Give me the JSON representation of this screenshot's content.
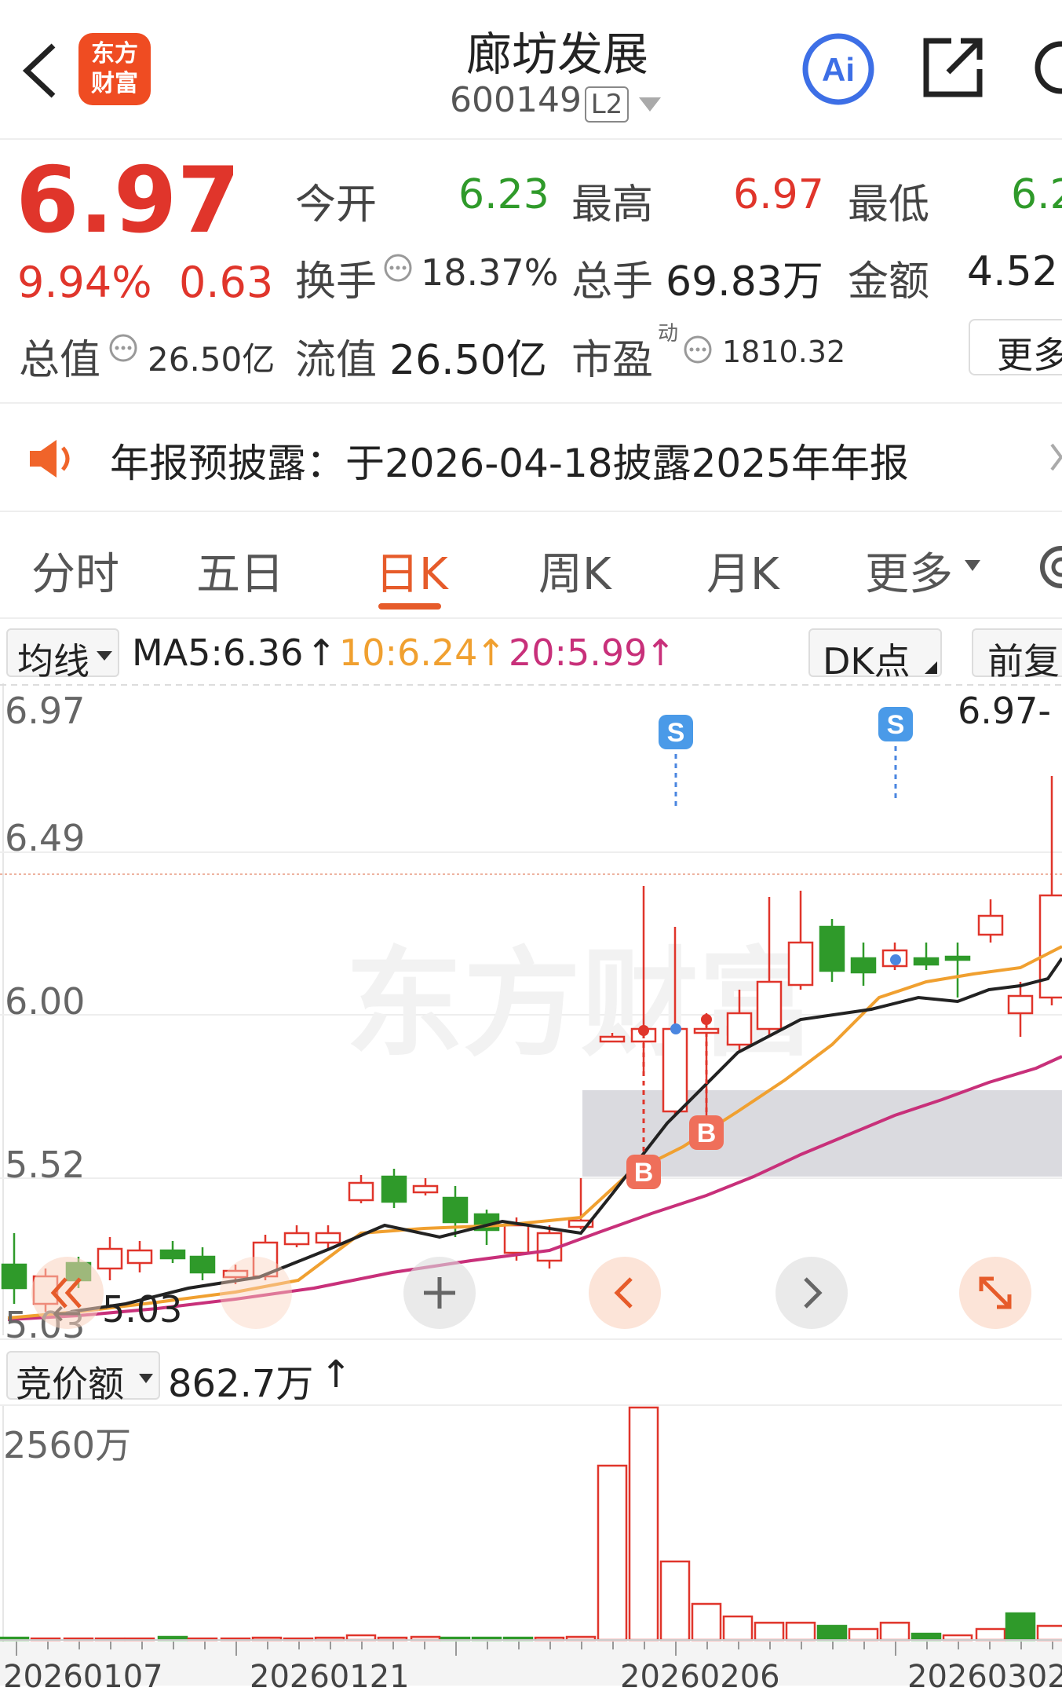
{
  "header": {
    "title": "廊坊发展",
    "code": "600149",
    "level": "L2",
    "logo_line1": "东方",
    "logo_line2": "财富",
    "ai_label": "Ai"
  },
  "quote": {
    "price": "6.97",
    "change_pct": "9.94%",
    "change_amt": "0.63",
    "open_label": "今开",
    "open": "6.23",
    "high_label": "最高",
    "high": "6.97",
    "low_label": "最低",
    "low": "6.2",
    "turnover_label": "换手",
    "turnover": "18.37%",
    "volume_label": "总手",
    "volume": "69.83万",
    "amount_label": "金额",
    "amount": "4.52",
    "mcap_label": "总值",
    "mcap": "26.50亿",
    "float_label": "流值",
    "float": "26.50亿",
    "pe_label": "市盈",
    "pe_sup": "动",
    "pe": "1810.32",
    "more": "更多"
  },
  "banner": {
    "text": "年报预披露：于2026-04-18披露2025年年报"
  },
  "tabs": [
    {
      "label": "分时"
    },
    {
      "label": "五日"
    },
    {
      "label": "日K"
    },
    {
      "label": "周K"
    },
    {
      "label": "月K"
    },
    {
      "label": "更多"
    }
  ],
  "ma_bar": {
    "selector": "均线",
    "ma5": "MA5:6.36",
    "ma10": "10:6.24",
    "ma20": "20:5.99",
    "dk": "DK点",
    "adjust": "前复"
  },
  "chart_data": {
    "type": "candlestick",
    "price_axis": [
      "6.97",
      "6.49",
      "6.00",
      "5.52",
      "5.03"
    ],
    "top_right_label": "6.97-",
    "low_label": "5.03",
    "volume_selector": "竞价额",
    "volume_value": "862.7万",
    "volume_axis_top": "2560万",
    "dates": [
      "20260107",
      "20260121",
      "20260206",
      "20260302"
    ],
    "markers": [
      "S",
      "S",
      "B",
      "B"
    ],
    "colors": {
      "up": "#e0352b",
      "down": "#2f9a2a",
      "ma5": "#222222",
      "ma10": "#f0a030",
      "ma20": "#c8307a"
    }
  }
}
